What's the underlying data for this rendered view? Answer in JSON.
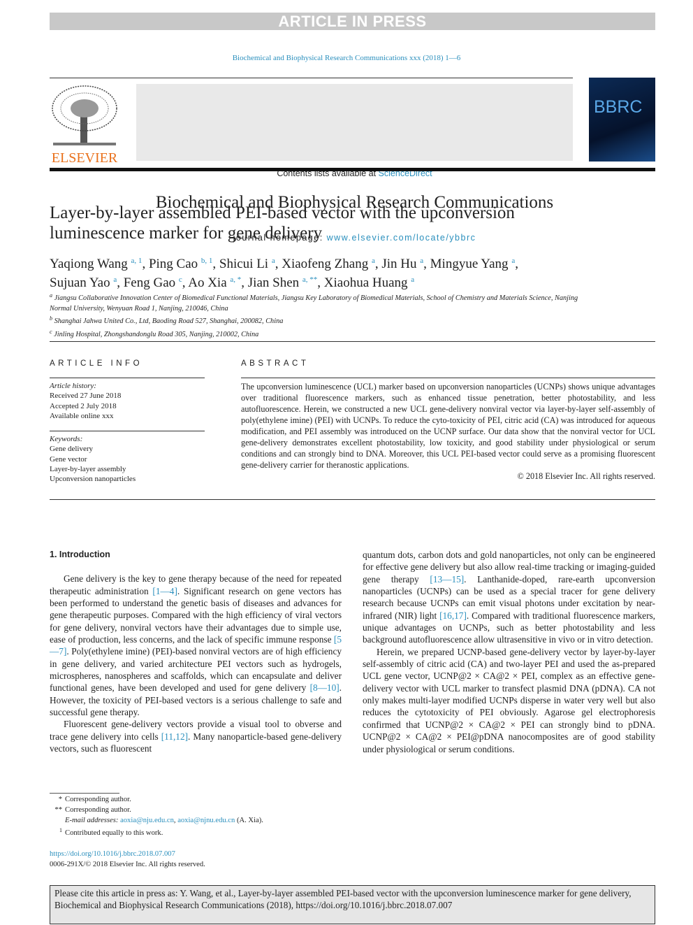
{
  "banner": "ARTICLE IN PRESS",
  "journal_ref": "Biochemical and Biophysical Research Communications xxx (2018) 1—6",
  "header": {
    "contents_prefix": "Contents lists available at ",
    "contents_link": "ScienceDirect",
    "journal_title": "Biochemical and Biophysical Research Communications",
    "homepage_prefix": "journal homepage: ",
    "homepage_link": "www.elsevier.com/locate/ybbrc",
    "publisher": "ELSEVIER",
    "cover_text": "BBRC"
  },
  "colors": {
    "link": "#2a8fbd",
    "elsevier": "#e9711c",
    "banner": "#c8c8c8"
  },
  "title": "Layer-by-layer assembled PEI-based vector with the upconversion luminescence marker for gene delivery",
  "authors": [
    {
      "name": "Yaqiong Wang",
      "sup": "a, 1"
    },
    {
      "name": "Ping Cao",
      "sup": "b, 1"
    },
    {
      "name": "Shicui Li",
      "sup": "a"
    },
    {
      "name": "Xiaofeng Zhang",
      "sup": "a"
    },
    {
      "name": "Jin Hu",
      "sup": "a"
    },
    {
      "name": "Mingyue Yang",
      "sup": "a"
    },
    {
      "name": "Sujuan Yao",
      "sup": "a"
    },
    {
      "name": "Feng Gao",
      "sup": "c"
    },
    {
      "name": "Ao Xia",
      "sup": "a, *"
    },
    {
      "name": "Jian Shen",
      "sup": "a, **"
    },
    {
      "name": "Xiaohua Huang",
      "sup": "a"
    }
  ],
  "affiliations": [
    {
      "key": "a",
      "text": "Jiangsu Collaborative Innovation Center of Biomedical Functional Materials, Jiangsu Key Laboratory of Biomedical Materials, School of Chemistry and Materials Science, Nanjing Normal University, Wenyuan Road 1, Nanjing, 210046, China"
    },
    {
      "key": "b",
      "text": "Shanghai Jahwa United Co., Ltd, Baoding Road 527, Shanghai, 200082, China"
    },
    {
      "key": "c",
      "text": "Jinling Hospital, Zhongshandonglu Road 305, Nanjing, 210002, China"
    }
  ],
  "article_info": {
    "heading": "ARTICLE INFO",
    "history_label": "Article history:",
    "history": [
      "Received 27 June 2018",
      "Accepted 2 July 2018",
      "Available online xxx"
    ],
    "keywords_label": "Keywords:",
    "keywords": [
      "Gene delivery",
      "Gene vector",
      "Layer-by-layer assembly",
      "Upconversion nanoparticles"
    ]
  },
  "abstract": {
    "heading": "ABSTRACT",
    "text": "The upconversion luminescence (UCL) marker based on upconversion nanoparticles (UCNPs) shows unique advantages over traditional fluorescence markers, such as enhanced tissue penetration, better photostability, and less autofluorescence. Herein, we constructed a new UCL gene-delivery nonviral vector via layer-by-layer self-assembly of poly(ethylene imine) (PEI) with UCNPs. To reduce the cyto-toxicity of PEI, citric acid (CA) was introduced for aqueous modification, and PEI assembly was introduced on the UCNP surface. Our data show that the nonviral vector for UCL gene-delivery demonstrates excellent photostability, low toxicity, and good stability under physiological or serum conditions and can strongly bind to DNA. Moreover, this UCL PEI-based vector could serve as a promising fluorescent gene-delivery carrier for theranostic applications.",
    "copyright": "© 2018 Elsevier Inc. All rights reserved."
  },
  "intro": {
    "heading": "1.  Introduction",
    "left": [
      [
        [
          "Gene delivery is the key to gene therapy because of the need for repeated therapeutic administration "
        ],
        [
          "[1—4]",
          1
        ],
        [
          ". Significant research on gene vectors has been performed to understand the genetic basis of diseases and advances for gene therapeutic purposes. Compared with the high efficiency of viral vectors for gene delivery, nonviral vectors have their advantages due to simple use, ease of production, less concerns, and the lack of specific immune response "
        ],
        [
          "[5—7]",
          1
        ],
        [
          ". Poly(ethylene imine) (PEI)-based nonviral vectors are of high efficiency in gene delivery, and varied architecture PEI vectors such as hydrogels, microspheres, nanospheres and scaffolds, which can encapsulate and deliver functional genes, have been developed and used for gene delivery "
        ],
        [
          "[8—10]",
          1
        ],
        [
          ". However, the toxicity of PEI-based vectors is a serious challenge to safe and successful gene therapy."
        ]
      ],
      [
        [
          "Fluorescent gene-delivery vectors provide a visual tool to obverse and trace gene delivery into cells "
        ],
        [
          "[11,12]",
          1
        ],
        [
          ". Many nanoparticle-based gene-delivery vectors, such as fluorescent"
        ]
      ]
    ],
    "right": [
      [
        [
          "quantum dots, carbon dots and gold nanoparticles, not only can be engineered for effective gene delivery but also allow real-time tracking or imaging-guided gene therapy "
        ],
        [
          "[13—15]",
          1
        ],
        [
          ". Lanthanide-doped, rare-earth upconversion nanoparticles (UCNPs) can be used as a special tracer for gene delivery research because UCNPs can emit visual photons under excitation by near-infrared (NIR) light "
        ],
        [
          "[16,17]",
          1
        ],
        [
          ". Compared with traditional fluorescence markers, unique advantages on UCNPs, such as better photostability and less background autofluorescence allow ultrasensitive in vivo or in vitro detection."
        ]
      ],
      [
        [
          "Herein, we prepared UCNP-based gene-delivery vector by layer-by-layer self-assembly of citric acid (CA) and two-layer PEI and used the as-prepared UCL gene vector, UCNP@2 × CA@2 × PEI, complex as an effective gene-delivery vector with UCL marker to transfect plasmid DNA (pDNA). CA not only makes multi-layer modified UCNPs disperse in water very well but also reduces the cytotoxicity of PEI obviously. Agarose gel electrophoresis confirmed that UCNP@2 × CA@2 × PEI can strongly bind to pDNA. UCNP@2 × CA@2 × PEI@pDNA nanocomposites are of good stability under physiological or serum conditions."
        ]
      ]
    ]
  },
  "footnotes": {
    "star": "*",
    "star_text": "Corresponding author.",
    "dstar": "**",
    "dstar_text": "Corresponding author.",
    "email_label": "E-mail addresses:",
    "email1": "aoxia@nju.edu.cn",
    "email2": "aoxia@njnu.edu.cn",
    "email_owner": " (A. Xia).",
    "one": "1",
    "one_text": "Contributed equally to this work.",
    "doi": "https://doi.org/10.1016/j.bbrc.2018.07.007",
    "issn": "0006-291X/© 2018 Elsevier Inc. All rights reserved."
  },
  "cite_box": "Please cite this article in press as: Y. Wang, et al., Layer-by-layer assembled PEI-based vector with the upconversion luminescence marker for gene delivery, Biochemical and Biophysical Research Communications (2018), https://doi.org/10.1016/j.bbrc.2018.07.007"
}
